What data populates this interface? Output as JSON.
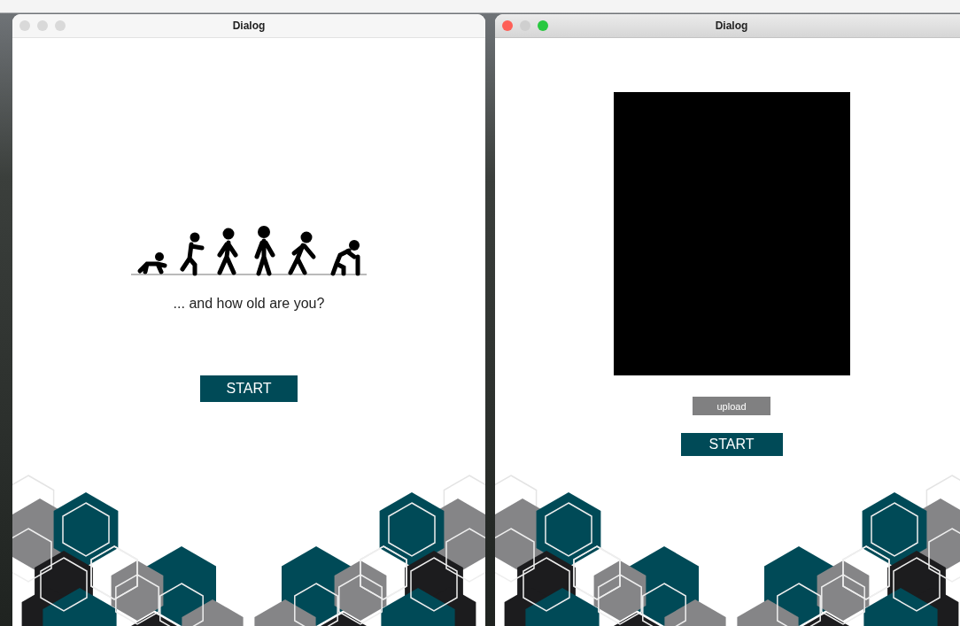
{
  "windows": [
    {
      "title": "Dialog",
      "active": false,
      "content": [
        {
          "kind": "figures"
        },
        {
          "kind": "prompt",
          "text": "... and how old are you?"
        },
        {
          "kind": "start",
          "label": "START"
        }
      ]
    },
    {
      "title": "Dialog",
      "active": true,
      "content": [
        {
          "kind": "preview"
        },
        {
          "kind": "upload",
          "label": "upload"
        },
        {
          "kind": "start",
          "label": "START"
        }
      ]
    }
  ]
}
